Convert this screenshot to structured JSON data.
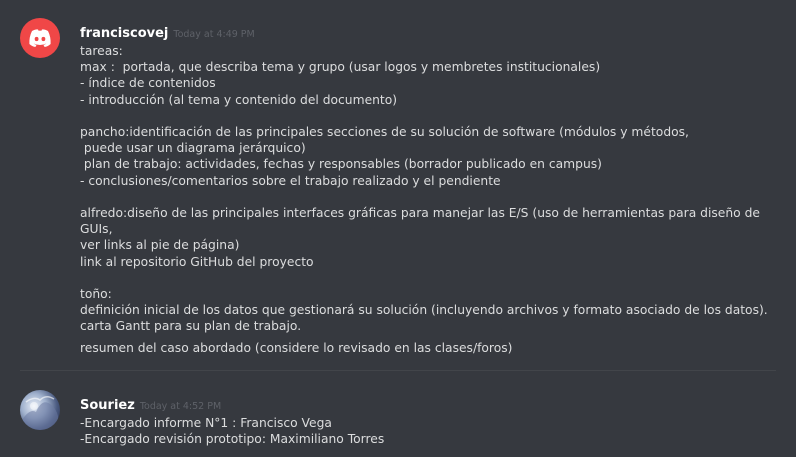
{
  "messages": [
    {
      "username": "franciscovej",
      "timestamp": "Today at 4:49 PM",
      "avatar_icon": "discord-logo-icon",
      "lines": [
        "tareas:",
        "max :  portada, que describa tema y grupo (usar logos y membretes institucionales)",
        "- índice de contenidos",
        "- introducción (al tema y contenido del documento)",
        "",
        "pancho:identificación de las principales secciones de su solución de software (módulos y métodos,",
        " puede usar un diagrama jerárquico)",
        " plan de trabajo: actividades, fechas y responsables (borrador publicado en campus)",
        "- conclusiones/comentarios sobre el trabajo realizado y el pendiente",
        "",
        "alfredo:diseño de las principales interfaces gráficas para manejar las E/S (uso de herramientas para diseño de GUIs,",
        "ver links al pie de página)",
        "link al repositorio GitHub del proyecto",
        "",
        "toño:",
        "definición inicial de los datos que gestionará su solución (incluyendo archivos y formato asociado de los datos).",
        "carta Gantt para su plan de trabajo.",
        "resumen del caso abordado (considere lo revisado en las clases/foros)"
      ]
    },
    {
      "username": "Souriez",
      "timestamp": "Today at 4:52 PM",
      "avatar_icon": "user-avatar-photo",
      "lines": [
        "-Encargado informe N°1 : Francisco Vega",
        "-Encargado revisión prototipo: Maximiliano Torres"
      ]
    }
  ],
  "colors": {
    "background": "#36393f",
    "username": "#ffffff",
    "timestamp": "#5e6168",
    "text": "#dcddde",
    "discord_avatar": "#f04747"
  }
}
